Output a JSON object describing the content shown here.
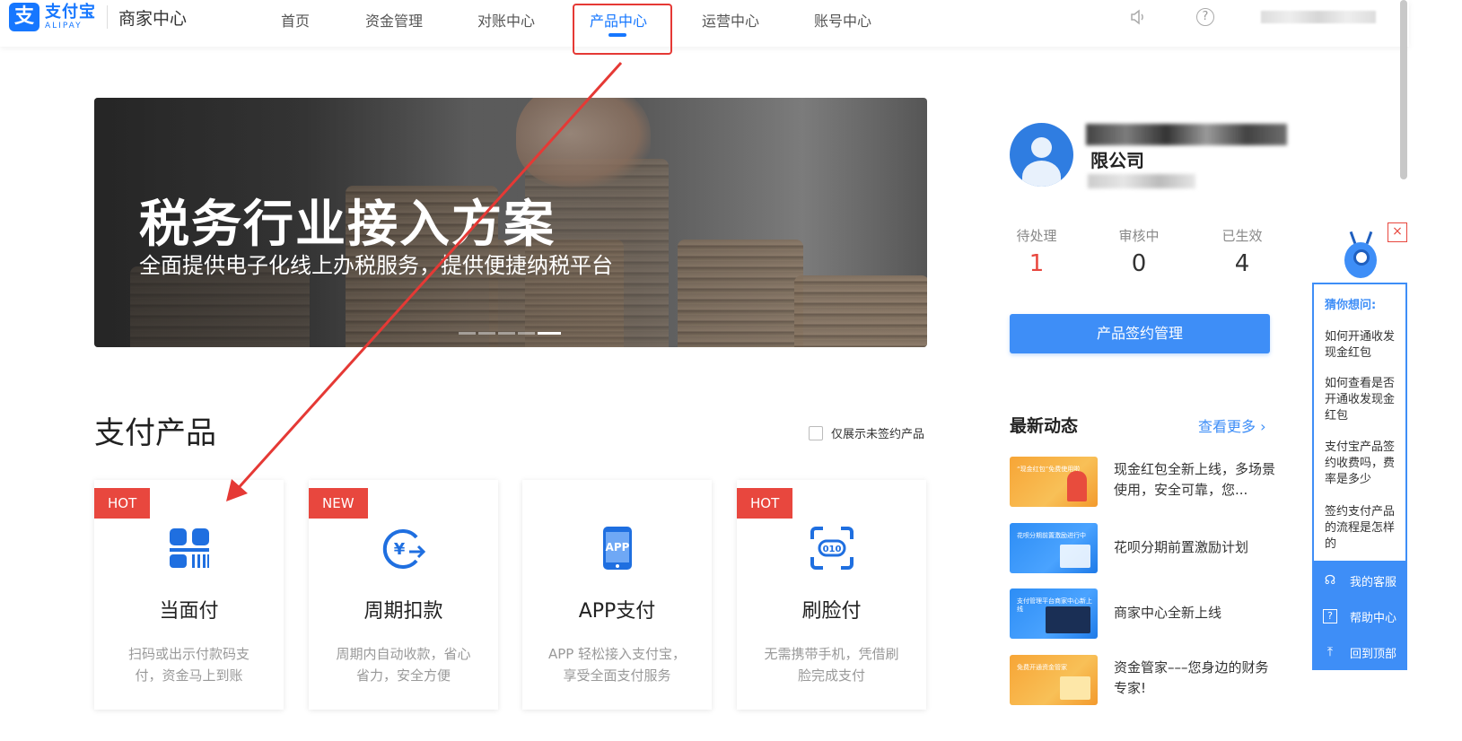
{
  "header": {
    "logo_cn": "支付宝",
    "logo_en": "ALIPAY",
    "logo_sub": "商家中心",
    "nav": [
      {
        "label": "首页"
      },
      {
        "label": "资金管理"
      },
      {
        "label": "对账中心"
      },
      {
        "label": "产品中心",
        "active": true
      },
      {
        "label": "运营中心"
      },
      {
        "label": "账号中心"
      }
    ],
    "icons": [
      "speaker-icon",
      "help-icon"
    ],
    "help_glyph": "?"
  },
  "banner": {
    "title": "税务行业接入方案",
    "subtitle": "全面提供电子化线上办税服务，提供便捷纳税平台",
    "slides": 5,
    "active_slide": 5
  },
  "section": {
    "title": "支付产品",
    "filter_label": "仅展示未签约产品"
  },
  "products": [
    {
      "badge": "HOT",
      "title": "当面付",
      "desc": "扫码或出示付款码支付，资金马上到账",
      "icon": "qr-pay-icon"
    },
    {
      "badge": "NEW",
      "title": "周期扣款",
      "desc": "周期内自动收款，省心省力，安全方便",
      "icon": "yuan-cycle-icon"
    },
    {
      "badge": "",
      "title": "APP支付",
      "desc": "APP 轻松接入支付宝，享受全面支付服务",
      "icon": "app-phone-icon",
      "icon_text": "APP"
    },
    {
      "badge": "HOT",
      "title": "刷脸付",
      "desc": "无需携带手机，凭借刷脸完成支付",
      "icon": "face-pay-icon",
      "icon_text": "010"
    }
  ],
  "profile": {
    "company_suffix": "限公司",
    "stats": [
      {
        "label": "待处理",
        "value": "1"
      },
      {
        "label": "审核中",
        "value": "0"
      },
      {
        "label": "已生效",
        "value": "4"
      }
    ],
    "sign_button": "产品签约管理"
  },
  "news": {
    "title": "最新动态",
    "more": "查看更多 ›",
    "items": [
      {
        "text": "现金红包全新上线，多场景使用，安全可靠，您...",
        "thumb": "orange",
        "thumb_caption": "“现金红包”免费使用啦"
      },
      {
        "text": "花呗分期前置激励计划",
        "thumb": "blue",
        "thumb_caption": "花呗分期前置激励进行中"
      },
      {
        "text": "商家中心全新上线",
        "thumb": "blue",
        "thumb_caption": "支付管理平台商家中心新上线"
      },
      {
        "text": "资金管家–––您身边的财务专家!",
        "thumb": "orange",
        "thumb_caption": "免费开通资金管家"
      }
    ]
  },
  "float_panel": {
    "close_glyph": "×",
    "guess_title": "猜你想问:",
    "questions": [
      "如何开通收发现金红包",
      "如何查看是否开通收发现金红包",
      "支付宝产品签约收费吗，费率是多少",
      "签约支付产品的流程是怎样的"
    ],
    "services": [
      {
        "label": "我的客服",
        "icon": "headset-icon",
        "glyph": "☊"
      },
      {
        "label": "帮助中心",
        "icon": "help-chat-icon",
        "glyph": "?"
      },
      {
        "label": "回到顶部",
        "icon": "back-to-top-icon",
        "glyph": "⤒"
      }
    ]
  },
  "colors": {
    "brand": "#1677ff",
    "accent": "#3e8ef7",
    "badge": "#e8473e",
    "annotation": "#e53935"
  }
}
